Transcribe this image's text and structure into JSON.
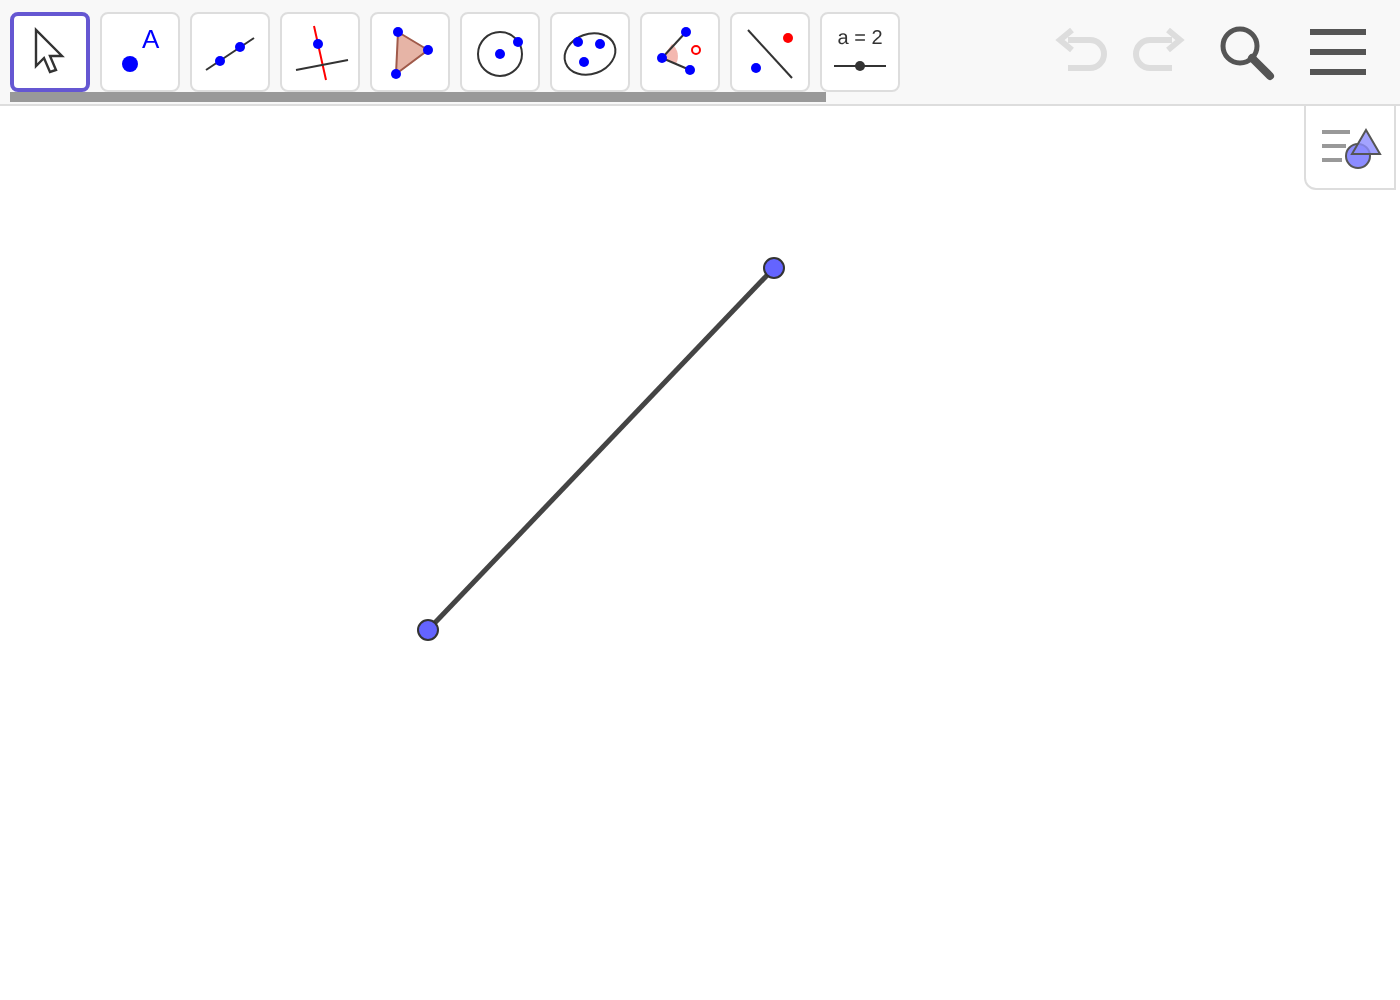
{
  "toolbar": {
    "tools": [
      {
        "kind": "move",
        "selected": true
      },
      {
        "kind": "point",
        "label": "A",
        "selected": false
      },
      {
        "kind": "line",
        "selected": false
      },
      {
        "kind": "perpendicular",
        "selected": false
      },
      {
        "kind": "polygon",
        "selected": false
      },
      {
        "kind": "circle",
        "selected": false
      },
      {
        "kind": "conic",
        "selected": false
      },
      {
        "kind": "angle",
        "selected": false
      },
      {
        "kind": "reflect",
        "selected": false
      },
      {
        "kind": "slider",
        "label": "a = 2",
        "selected": false
      }
    ],
    "undo": {
      "disabled": true
    },
    "redo": {
      "disabled": true
    }
  }
}
